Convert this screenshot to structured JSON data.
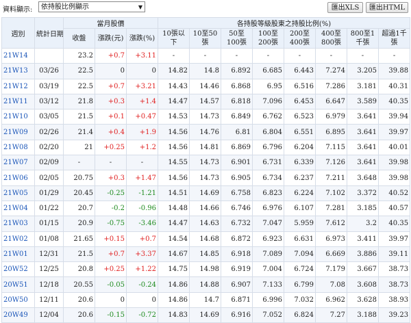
{
  "toolbar": {
    "label": "資料顯示:",
    "select_value": "依持股比例顯示",
    "xls_button": "匯出XLS",
    "html_button": "匯出HTML"
  },
  "header": {
    "week": "週別",
    "date": "統計日期",
    "price_group": "當月股價",
    "close": "收盤",
    "change": "漲跌(元)",
    "change_pct": "漲跌(%)",
    "holders_group": "各持股等級股東之持股比例(%)",
    "levels": [
      "10張以下",
      "10至50張",
      "50至100張",
      "100至200張",
      "200至400張",
      "400至800張",
      "800至1千張",
      "超過1千張"
    ]
  },
  "rows": [
    {
      "week": "21W14",
      "date": "",
      "close": "23.2",
      "chg": "+0.7",
      "pct": "+3.11",
      "lv": [
        "-",
        "-",
        "-",
        "-",
        "-",
        "-",
        "-",
        "-"
      ]
    },
    {
      "week": "21W13",
      "date": "03/26",
      "close": "22.5",
      "chg": "0",
      "pct": "0",
      "lv": [
        "14.82",
        "14.8",
        "6.892",
        "6.685",
        "6.443",
        "7.274",
        "3.205",
        "39.88"
      ]
    },
    {
      "week": "21W12",
      "date": "03/19",
      "close": "22.5",
      "chg": "+0.7",
      "pct": "+3.21",
      "lv": [
        "14.43",
        "14.46",
        "6.868",
        "6.95",
        "6.516",
        "7.286",
        "3.181",
        "40.31"
      ]
    },
    {
      "week": "21W11",
      "date": "03/12",
      "close": "21.8",
      "chg": "+0.3",
      "pct": "+1.4",
      "lv": [
        "14.47",
        "14.57",
        "6.818",
        "7.096",
        "6.453",
        "6.647",
        "3.589",
        "40.35"
      ]
    },
    {
      "week": "21W10",
      "date": "03/05",
      "close": "21.5",
      "chg": "+0.1",
      "pct": "+0.47",
      "lv": [
        "14.53",
        "14.73",
        "6.849",
        "6.762",
        "6.523",
        "6.979",
        "3.641",
        "39.94"
      ]
    },
    {
      "week": "21W09",
      "date": "02/26",
      "close": "21.4",
      "chg": "+0.4",
      "pct": "+1.9",
      "lv": [
        "14.56",
        "14.76",
        "6.81",
        "6.804",
        "6.551",
        "6.895",
        "3.641",
        "39.97"
      ]
    },
    {
      "week": "21W08",
      "date": "02/20",
      "close": "21",
      "chg": "+0.25",
      "pct": "+1.2",
      "lv": [
        "14.56",
        "14.81",
        "6.869",
        "6.796",
        "6.204",
        "7.115",
        "3.641",
        "40.01"
      ]
    },
    {
      "week": "21W07",
      "date": "02/09",
      "close": "-",
      "chg": "-",
      "pct": "-",
      "lv": [
        "14.55",
        "14.73",
        "6.901",
        "6.731",
        "6.339",
        "7.126",
        "3.641",
        "39.98"
      ]
    },
    {
      "week": "21W06",
      "date": "02/05",
      "close": "20.75",
      "chg": "+0.3",
      "pct": "+1.47",
      "lv": [
        "14.56",
        "14.73",
        "6.905",
        "6.734",
        "6.237",
        "7.211",
        "3.648",
        "39.98"
      ]
    },
    {
      "week": "21W05",
      "date": "01/29",
      "close": "20.45",
      "chg": "-0.25",
      "pct": "-1.21",
      "lv": [
        "14.51",
        "14.69",
        "6.758",
        "6.823",
        "6.224",
        "7.102",
        "3.372",
        "40.52"
      ]
    },
    {
      "week": "21W04",
      "date": "01/22",
      "close": "20.7",
      "chg": "-0.2",
      "pct": "-0.96",
      "lv": [
        "14.48",
        "14.66",
        "6.746",
        "6.976",
        "6.107",
        "7.281",
        "3.185",
        "40.57"
      ]
    },
    {
      "week": "21W03",
      "date": "01/15",
      "close": "20.9",
      "chg": "-0.75",
      "pct": "-3.46",
      "lv": [
        "14.47",
        "14.63",
        "6.732",
        "7.047",
        "5.959",
        "7.612",
        "3.2",
        "40.35"
      ]
    },
    {
      "week": "21W02",
      "date": "01/08",
      "close": "21.65",
      "chg": "+0.15",
      "pct": "+0.7",
      "lv": [
        "14.54",
        "14.68",
        "6.872",
        "6.923",
        "6.631",
        "6.973",
        "3.411",
        "39.97"
      ]
    },
    {
      "week": "21W01",
      "date": "12/31",
      "close": "21.5",
      "chg": "+0.7",
      "pct": "+3.37",
      "lv": [
        "14.67",
        "14.85",
        "6.918",
        "7.089",
        "7.094",
        "6.669",
        "3.886",
        "39.11"
      ]
    },
    {
      "week": "20W52",
      "date": "12/25",
      "close": "20.8",
      "chg": "+0.25",
      "pct": "+1.22",
      "lv": [
        "14.75",
        "14.98",
        "6.919",
        "7.004",
        "6.724",
        "7.179",
        "3.667",
        "38.73"
      ]
    },
    {
      "week": "20W51",
      "date": "12/18",
      "close": "20.55",
      "chg": "-0.05",
      "pct": "-0.24",
      "lv": [
        "14.86",
        "14.88",
        "6.907",
        "7.133",
        "6.799",
        "7.08",
        "3.608",
        "38.73"
      ]
    },
    {
      "week": "20W50",
      "date": "12/11",
      "close": "20.6",
      "chg": "0",
      "pct": "0",
      "lv": [
        "14.86",
        "14.7",
        "6.871",
        "6.996",
        "7.032",
        "6.962",
        "3.628",
        "38.93"
      ]
    },
    {
      "week": "20W49",
      "date": "12/04",
      "close": "20.6",
      "chg": "-0.15",
      "pct": "-0.72",
      "lv": [
        "14.83",
        "14.69",
        "6.916",
        "7.052",
        "6.824",
        "7.27",
        "3.188",
        "39.23"
      ]
    }
  ]
}
